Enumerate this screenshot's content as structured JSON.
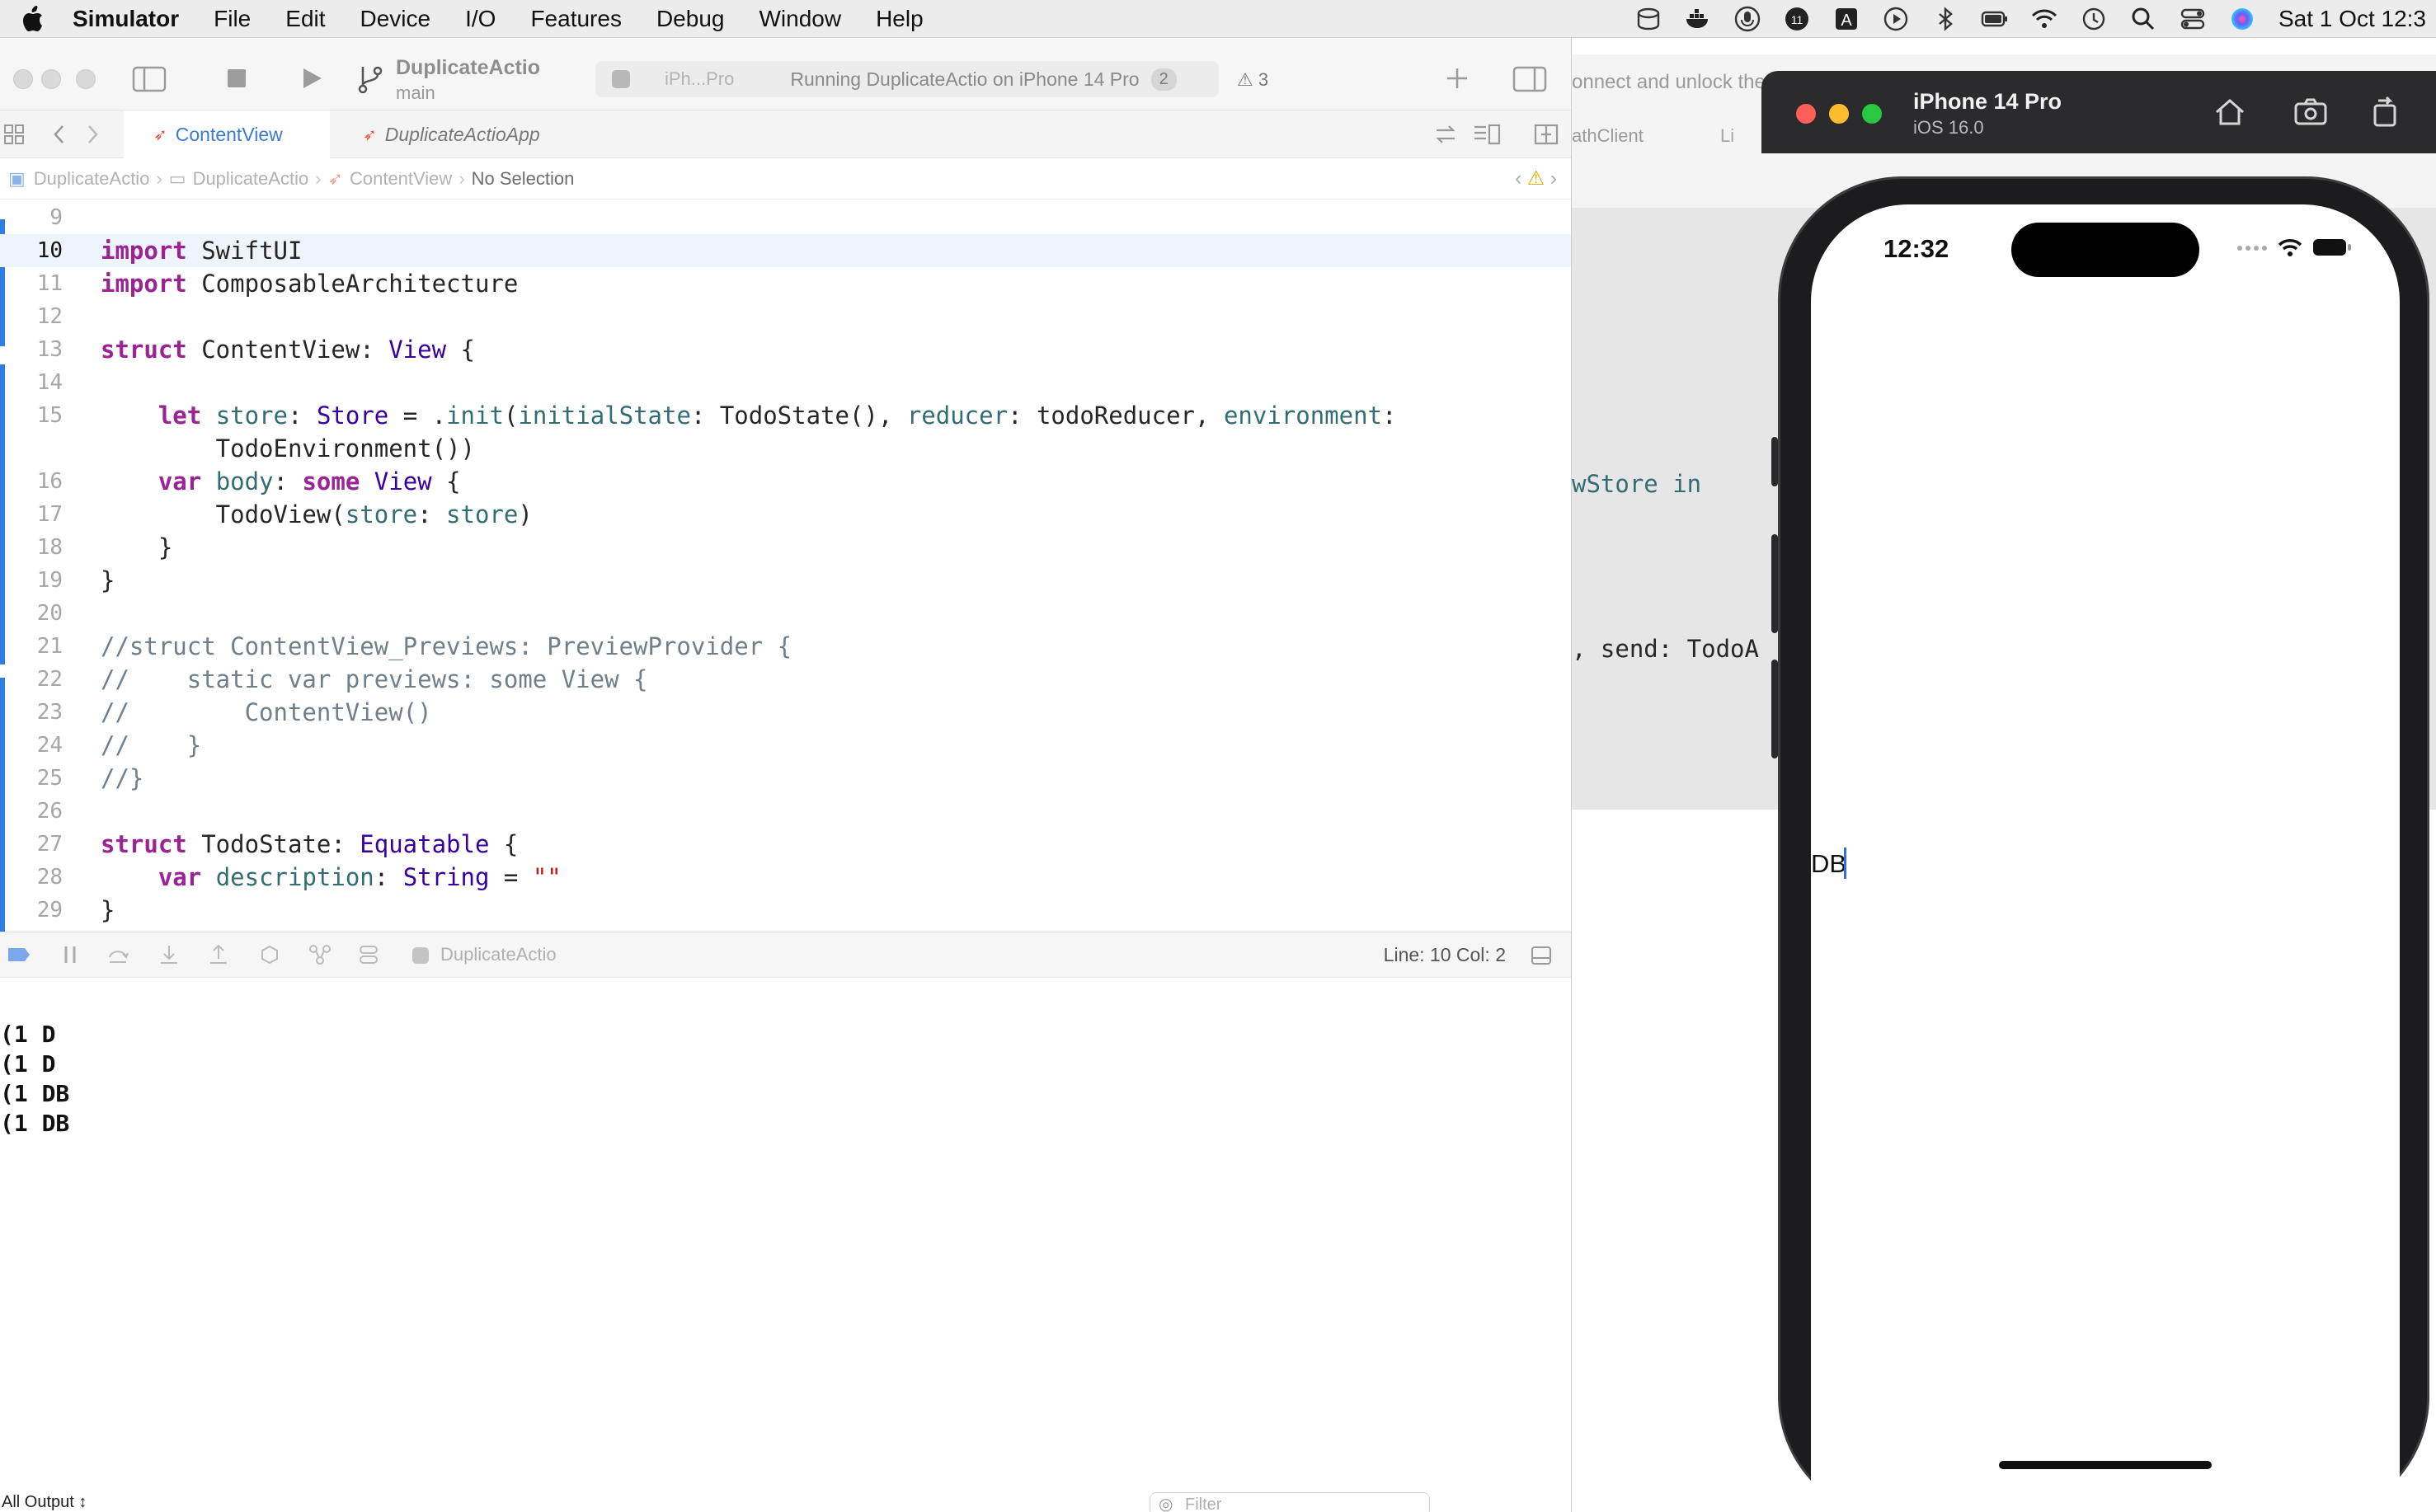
{
  "menubar": {
    "app_name": "Simulator",
    "items": [
      "File",
      "Edit",
      "Device",
      "I/O",
      "Features",
      "Debug",
      "Window",
      "Help"
    ],
    "clock": "Sat 1 Oct  12:3"
  },
  "xcode": {
    "scheme_name": "DuplicateActio",
    "branch": "main",
    "activity_device": "iPh...Pro",
    "activity_status": "Running DuplicateActio on iPhone 14 Pro",
    "activity_badge": "2",
    "warning_count": "3",
    "tabs": [
      {
        "label": "ContentView",
        "active": true
      },
      {
        "label": "DuplicateActioApp",
        "active": false
      }
    ],
    "breadcrumb": [
      "DuplicateActio",
      "DuplicateActio",
      "ContentView",
      "No Selection"
    ],
    "code_lines": [
      {
        "n": "9",
        "text": ""
      },
      {
        "n": "10",
        "text": "import SwiftUI"
      },
      {
        "n": "11",
        "text": "import ComposableArchitecture"
      },
      {
        "n": "12",
        "text": ""
      },
      {
        "n": "13",
        "text": "struct ContentView: View {"
      },
      {
        "n": "14",
        "text": ""
      },
      {
        "n": "15",
        "text": "    let store: Store = .init(initialState: TodoState(), reducer: todoReducer, environment:"
      },
      {
        "n": "",
        "text": "        TodoEnvironment())"
      },
      {
        "n": "16",
        "text": "    var body: some View {"
      },
      {
        "n": "17",
        "text": "        TodoView(store: store)"
      },
      {
        "n": "18",
        "text": "    }"
      },
      {
        "n": "19",
        "text": "}"
      },
      {
        "n": "20",
        "text": ""
      },
      {
        "n": "21",
        "text": "//struct ContentView_Previews: PreviewProvider {"
      },
      {
        "n": "22",
        "text": "//    static var previews: some View {"
      },
      {
        "n": "23",
        "text": "//        ContentView()"
      },
      {
        "n": "24",
        "text": "//    }"
      },
      {
        "n": "25",
        "text": "//}"
      },
      {
        "n": "26",
        "text": ""
      },
      {
        "n": "27",
        "text": "struct TodoState: Equatable {"
      },
      {
        "n": "28",
        "text": "    var description: String = \"\""
      },
      {
        "n": "29",
        "text": "}"
      }
    ],
    "debug_target": "DuplicateActio",
    "line_col": "Line: 10  Col: 2",
    "console_lines": [
      "(1 D",
      "(1 D",
      "(1 DB",
      "(1 DB"
    ],
    "output_selector": "All Output ↕",
    "filter_placeholder": "Filter"
  },
  "background_window": {
    "title_fragment": "onnect and unlock the",
    "tab_fragment": "athClient",
    "tab_fragment2": "Li",
    "code_fragment_1": "wStore in",
    "code_fragment_2": ", send: TodoA"
  },
  "simulator": {
    "device_name": "iPhone 14 Pro",
    "os_version": "iOS 16.0",
    "phone_time": "12:32",
    "text_field_value": "DB"
  },
  "colors": {
    "accent": "#3b7bd8",
    "keyword": "#9b2393",
    "type": "#3900a0",
    "identifier": "#326d74",
    "comment": "#707f8c",
    "string": "#c41a16"
  }
}
